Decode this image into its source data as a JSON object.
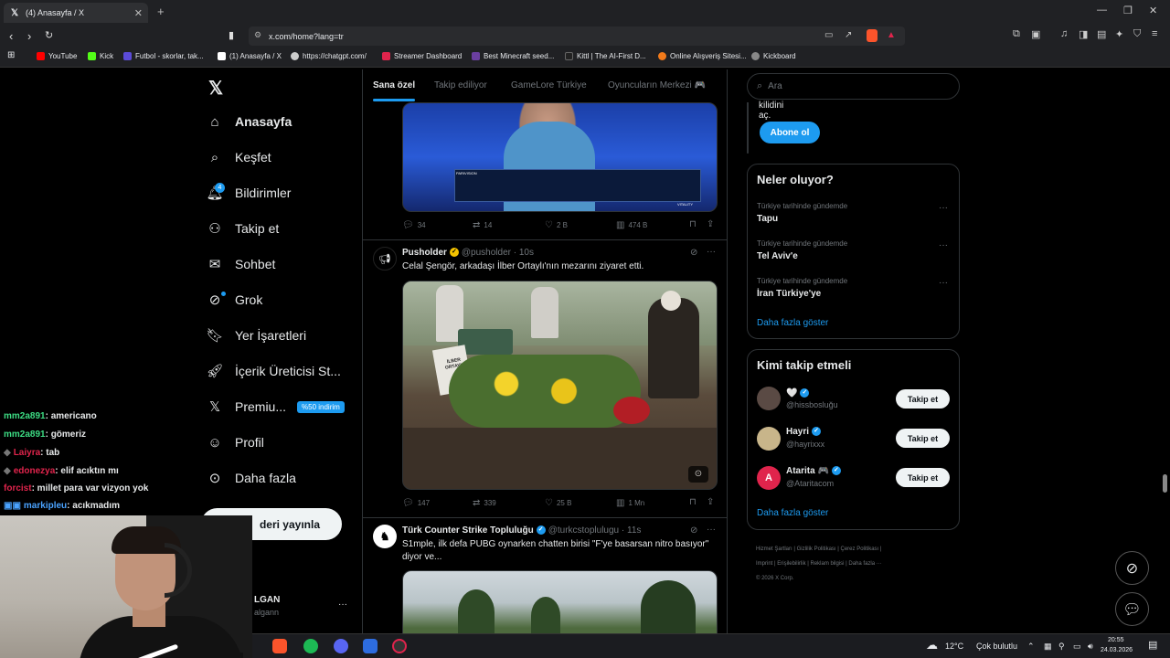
{
  "browser": {
    "tab_title": "(4) Anasayfa / X",
    "url": "x.com/home?lang=tr",
    "bookmarks": [
      {
        "label": "YouTube",
        "color": "#ff0000"
      },
      {
        "label": "Kick",
        "color": "#53fc18"
      },
      {
        "label": "Futbol - skorlar, tak...",
        "color": "#5b4bd8"
      },
      {
        "label": "(1) Anasayfa / X",
        "color": "#ffffff"
      },
      {
        "label": "https://chatgpt.com/",
        "color": "#cccccc"
      },
      {
        "label": "Streamer Dashboard",
        "color": "#e0244c"
      },
      {
        "label": "Best Minecraft seed...",
        "color": "#6b3fa0"
      },
      {
        "label": "Kittl | The AI-First D...",
        "color": "#222222"
      },
      {
        "label": "Online Alışveriş Sitesi...",
        "color": "#f27a1a"
      },
      {
        "label": "Kickboard",
        "color": "#888888"
      }
    ]
  },
  "sidebar": {
    "items": [
      {
        "label": "Anasayfa"
      },
      {
        "label": "Keşfet"
      },
      {
        "label": "Bildirimler",
        "count": "4"
      },
      {
        "label": "Takip et"
      },
      {
        "label": "Sohbet"
      },
      {
        "label": "Grok"
      },
      {
        "label": "Yer İşaretleri"
      },
      {
        "label": "İçerik Üreticisi St..."
      },
      {
        "label": "Premiu...",
        "badge": "%50 indirim"
      },
      {
        "label": "Profil"
      },
      {
        "label": "Daha fazla"
      }
    ],
    "post_button": "deri yayınla",
    "account_name": "LGAN",
    "account_handle": "algann"
  },
  "home_tabs": [
    "Sana özel",
    "Takip ediliyor",
    "GameLore Türkiye",
    "Oyuncuların Merkezi 🎮"
  ],
  "tweets": [
    {
      "image_overlay_brand": "PARIVISION",
      "image_overlay_team": "VITALITY",
      "stats": {
        "replies": "34",
        "retweets": "14",
        "likes": "2 B",
        "views": "474 B"
      }
    },
    {
      "name": "Pusholder",
      "handle": "@pusholder",
      "time": "· 10s",
      "text": "Celal Şengör, arkadaşı İlber Ortaylı'nın mezarını ziyaret etti.",
      "gravestone_text": "İLBER ORTAYLI",
      "stats": {
        "replies": "147",
        "retweets": "339",
        "likes": "25 B",
        "views": "1 Mn"
      }
    },
    {
      "name": "Türk Counter Strike Topluluğu",
      "handle": "@turkcstoplulugu",
      "time": "· 11s",
      "text": "S1mple, ilk defa PUBG oynarken chatten birisi \"F'ye basarsan nitro basıyor\" diyor ve..."
    }
  ],
  "search": {
    "placeholder": "Ara"
  },
  "premium_card": {
    "text": "kilidini aç.",
    "button": "Abone ol"
  },
  "trends": {
    "title": "Neler oluyor?",
    "items": [
      {
        "category": "Türkiye tarihinde gündemde",
        "name": "Tapu"
      },
      {
        "category": "Türkiye tarihinde gündemde",
        "name": "Tel Aviv'e"
      },
      {
        "category": "Türkiye tarihinde gündemde",
        "name": "İran Türkiye'ye"
      }
    ],
    "show_more": "Daha fazla göster"
  },
  "who_to_follow": {
    "title": "Kimi takip etmeli",
    "users": [
      {
        "name": "🤍",
        "handle": "@hissbosluğu",
        "button": "Takip et"
      },
      {
        "name": "Hayri",
        "handle": "@hayrixxx",
        "button": "Takip et"
      },
      {
        "name": "Atarita 🎮",
        "handle": "@Ataritacom",
        "button": "Takip et"
      }
    ],
    "show_more": "Daha fazla göster"
  },
  "footer": {
    "links": [
      "Hizmet Şartları",
      "Gizlilik Politikası",
      "Çerez Politikası",
      "Imprint",
      "Erişilebilirlik",
      "Reklam bilgisi",
      "Daha fazla ···"
    ],
    "copyright": "© 2026 X Corp."
  },
  "chat": [
    {
      "user": "mm2a891",
      "msg": ": americano",
      "color": "#3ddc84"
    },
    {
      "user": "mm2a891",
      "msg": ": gömeriz",
      "color": "#3ddc84"
    },
    {
      "user": "Laiyra",
      "msg": ": tab",
      "color": "#e0244c"
    },
    {
      "user": "edonezya",
      "msg": ": elif acıktın mı",
      "color": "#e0244c"
    },
    {
      "user": "forcist",
      "msg": ": millet para var vizyon yok",
      "color": "#e0244c"
    },
    {
      "user": "markipleu",
      "msg": ": acıkmadım",
      "color": "#4aa3ff"
    }
  ],
  "taskbar": {
    "temperature": "12°C",
    "weather": "Çok bulutlu",
    "time": "20:55",
    "date": "24.03.2026"
  }
}
